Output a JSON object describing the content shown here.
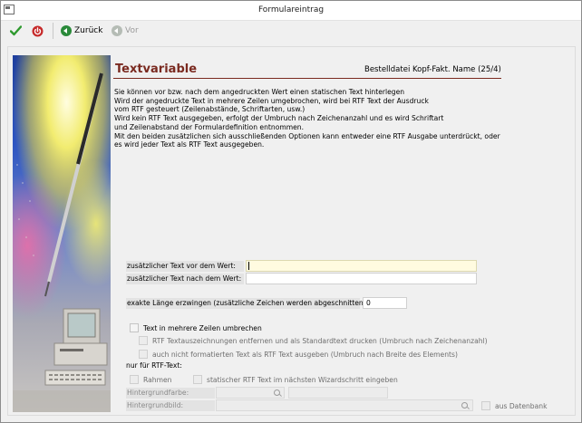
{
  "window": {
    "title": "Formulareintrag"
  },
  "toolbar": {
    "ok_icon": "checkmark-icon",
    "cancel_icon": "power-icon",
    "back_label": "Zurück",
    "forward_label": "Vor"
  },
  "content": {
    "heading": "Textvariable",
    "subheading": "Bestelldatei Kopf-Fakt. Name (25/4)",
    "description": "Sie können vor bzw. nach dem angedruckten Wert einen statischen Text hinterlegen\nWird der angedruckte Text in mehrere Zeilen umgebrochen, wird bei RTF Text der Ausdruck\nvom RTF gesteuert (Zeilenabstände, Schriftarten, usw.)\nWird kein RTF Text ausgegeben, erfolgt der Umbruch nach Zeichenanzahl und es wird Schriftart\nund Zeilenabstand der Formulardefinition entnommen.\nMit den beiden zusätzlichen sich ausschließenden Optionen kann entweder eine RTF Ausgabe unterdrückt, oder\nes wird jeder Text als RTF Text ausgegeben."
  },
  "form": {
    "text_before_label": "zusätzlicher Text vor dem Wert:",
    "text_before_value": "",
    "text_after_label": "zusätzlicher Text nach dem Wert:",
    "text_after_value": "",
    "exact_length_label": "exakte Länge erzwingen (zusätzliche Zeichen werden abgeschnitten)",
    "exact_length_value": "0",
    "wrap_label": "Text in mehrere Zeilen umbrechen",
    "rtf_remove_label": "RTF Textauszeichnungen entfernen und als Standardtext drucken (Umbruch nach Zeichenanzahl)",
    "rtf_unformatted_label": "auch nicht formatierten Text als RTF Text ausgeben (Umbruch nach Breite des Elements)",
    "rtf_only_label": "nur für RTF-Text:",
    "frame_label": "Rahmen",
    "static_rtf_label": "statischer RTF Text im nächsten Wizardschritt eingeben",
    "bg_color_label": "Hintergrundfarbe:",
    "bg_image_label": "Hintergrundbild:",
    "from_db_label": "aus Datenbank"
  }
}
